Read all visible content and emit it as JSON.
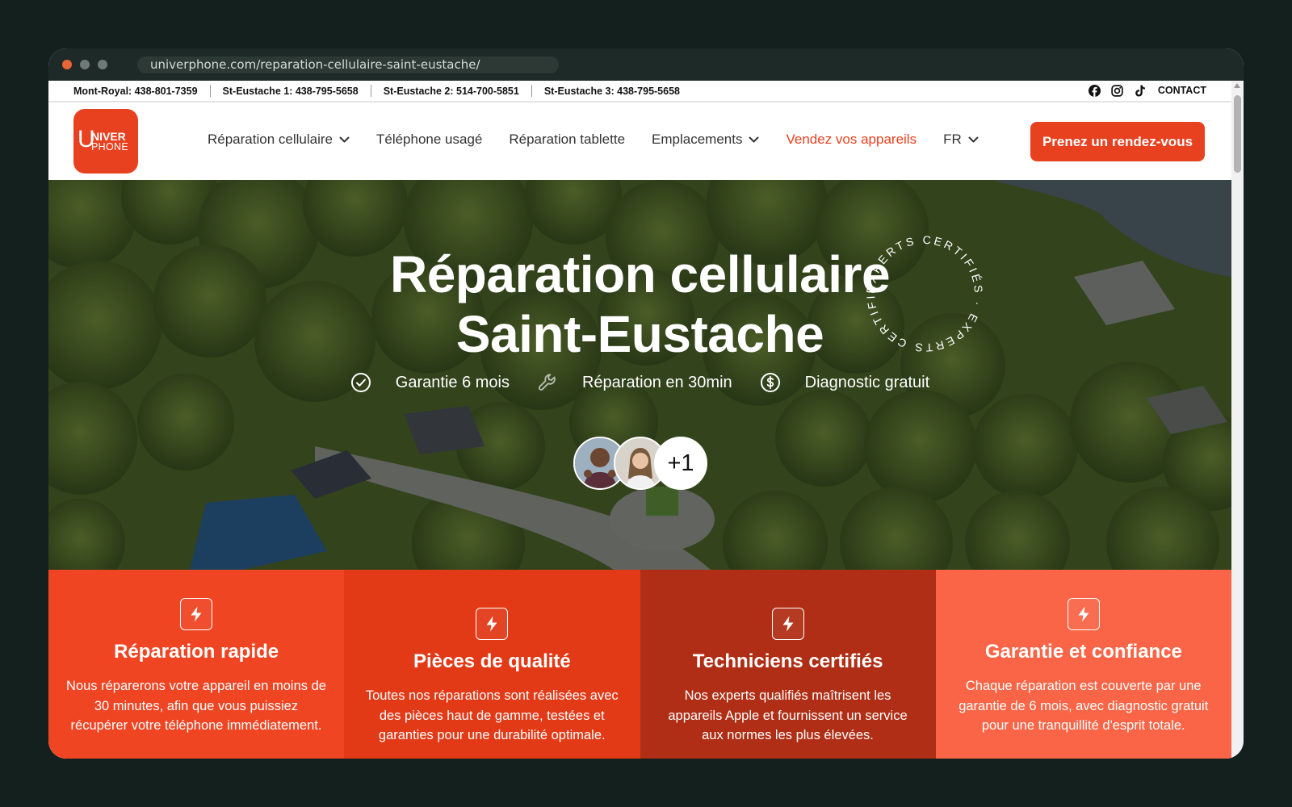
{
  "browser": {
    "url": "univerphone.com/reparation-cellulaire-saint-eustache/"
  },
  "topbar": {
    "phones": [
      "Mont-Royal: 438-801-7359",
      "St-Eustache 1: 438-795-5658",
      "St-Eustache 2: 514-700-5851",
      "St-Eustache 3: 438-795-5658"
    ],
    "socials": [
      "facebook-icon",
      "instagram-icon",
      "tiktok-icon"
    ],
    "contact": "CONTACT"
  },
  "logo": {
    "big_letter": "U",
    "line1": "NIVER",
    "line2": "PHONE"
  },
  "nav": {
    "items": [
      {
        "label": "Réparation cellulaire",
        "has_dropdown": true
      },
      {
        "label": "Téléphone usagé",
        "has_dropdown": false
      },
      {
        "label": "Réparation tablette",
        "has_dropdown": false
      },
      {
        "label": "Emplacements",
        "has_dropdown": true
      },
      {
        "label": "Vendez vos appareils",
        "has_dropdown": false
      },
      {
        "label": "FR",
        "has_dropdown": true
      }
    ],
    "cta": "Prenez un rendez-vous"
  },
  "hero": {
    "title_line1": "Réparation cellulaire",
    "title_line2": "Saint-Eustache",
    "badge_text": "EXPERTS CERTIFIÉS · EXPERTS CERTIFIÉS · ",
    "features": [
      {
        "icon": "check-circle-icon",
        "label": "Garantie 6 mois"
      },
      {
        "icon": "wrench-icon",
        "label": "Réparation en 30min"
      },
      {
        "icon": "dollar-circle-icon",
        "label": "Diagnostic gratuit"
      }
    ],
    "avatars_more": "+1"
  },
  "cards": [
    {
      "icon": "lightning-icon",
      "title": "Réparation rapide",
      "text": "Nous réparerons votre appareil en moins de 30 minutes, afin que vous puissiez récupérer votre téléphone immédiatement."
    },
    {
      "icon": "lightning-icon",
      "title": "Pièces de qualité",
      "text": "Toutes nos réparations sont réalisées avec des pièces haut de gamme, testées et garanties pour une durabilité optimale."
    },
    {
      "icon": "lightning-icon",
      "title": "Techniciens certifiés",
      "text": "Nos experts qualifiés maîtrisent les appareils Apple et fournissent un service aux normes les plus élevées."
    },
    {
      "icon": "lightning-icon",
      "title": "Garantie et confiance",
      "text": "Chaque réparation est couverte par une garantie de 6 mois, avec diagnostic gratuit pour une tranquillité d'esprit totale."
    }
  ],
  "colors": {
    "brand": "#e8411f",
    "card1": "#ef4523",
    "card2": "#e23a17",
    "card3": "#b02e15",
    "card4": "#f96546"
  }
}
